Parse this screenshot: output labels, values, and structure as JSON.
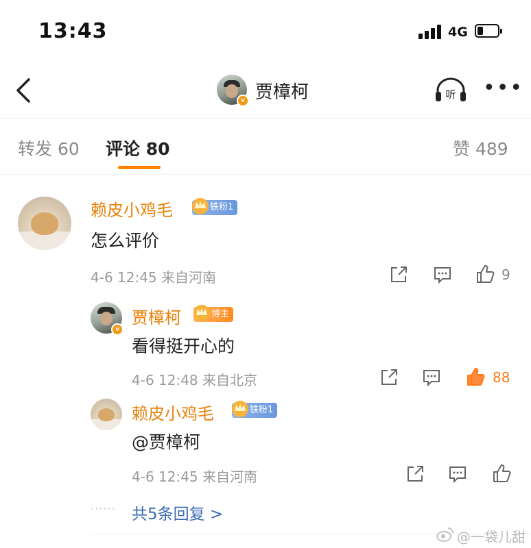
{
  "status_bar": {
    "time": "13:43",
    "network": "4G"
  },
  "header": {
    "title": "贾樟柯"
  },
  "tabs": [
    {
      "label": "转发",
      "count": "60"
    },
    {
      "label": "评论",
      "count": "80"
    },
    {
      "label": "赞",
      "count": "489"
    }
  ],
  "comments": [
    {
      "user": "赖皮小鸡毛",
      "badge": "铁粉1",
      "text": "怎么评价",
      "time": "4-6 12:45",
      "source": "来自河南",
      "likes": "9"
    },
    {
      "user": "贾樟柯",
      "badge": "博主",
      "text": "看得挺开心的",
      "time": "4-6 12:48",
      "source": "来自北京",
      "likes": "88"
    },
    {
      "user": "赖皮小鸡毛",
      "badge": "铁粉1",
      "text": "@贾樟柯",
      "time": "4-6 12:45",
      "source": "来自河南",
      "likes": ""
    }
  ],
  "replies": {
    "dots": "······",
    "label": "共5条回复 >"
  },
  "watermark": "@一袋儿甜",
  "colors": {
    "accent": "#ff8200",
    "username": "#e8820c",
    "link": "#3d6bb5"
  }
}
